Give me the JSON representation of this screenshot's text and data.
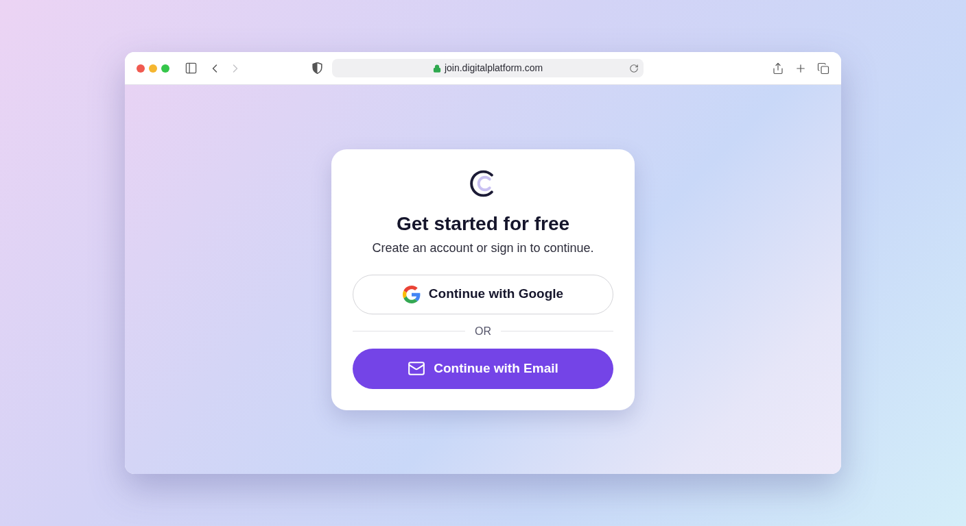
{
  "browser": {
    "navigation": [
      {
        "kind": "back",
        "disabled": false
      },
      {
        "kind": "forward",
        "disabled": true
      }
    ],
    "address": {
      "url": "join.digitalplatform.com",
      "secure": true
    }
  },
  "card": {
    "title": "Get started for free",
    "subtitle": "Create an account or sign in to continue.",
    "actions": [
      {
        "kind": "google",
        "label": "Continue with Google"
      },
      {
        "kind": "divider",
        "label": "OR"
      },
      {
        "kind": "email",
        "label": "Continue with Email"
      }
    ]
  }
}
